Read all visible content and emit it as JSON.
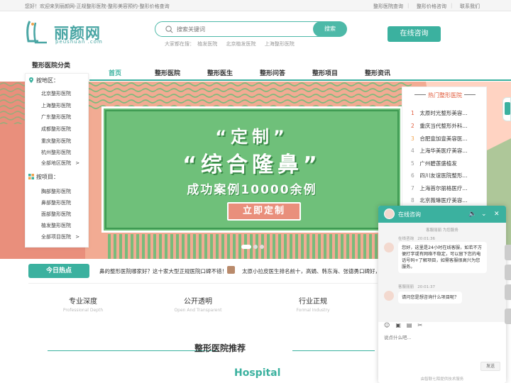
{
  "topbar": {
    "welcome": "您好！欢迎来到丽颜网-正规整形医院-整形美容预约-整形价格查询",
    "links": [
      "整形医院查询",
      "整形价格咨询",
      "联系我们"
    ],
    "sep": "|"
  },
  "logo": {
    "name": "丽颜网",
    "domain": "peushuan .com",
    "icon": "logo-mark"
  },
  "search": {
    "placeholder": "搜索关键词",
    "button": "搜索",
    "icon": "search-icon"
  },
  "hot": {
    "label": "大家都在搜：",
    "items": [
      "植发医院",
      "北京植发医院",
      "上海整形医院"
    ]
  },
  "consult_button": "在线咨询",
  "category_title": "整形医院分类",
  "nav": [
    "首页",
    "整形医院",
    "整形医生",
    "整形问答",
    "整形项目",
    "整形资讯"
  ],
  "left_menu": {
    "region": {
      "title": "按地区：",
      "icon": "location-pin-icon",
      "items": [
        "北京整形医院",
        "上海整形医院",
        "广东整形医院",
        "成都整形医院",
        "重庆整形医院",
        "杭州整形医院",
        "全部地区医院"
      ]
    },
    "project": {
      "title": "按项目：",
      "icon": "grid-icon",
      "items": [
        "胸部整形医院",
        "鼻部整形医院",
        "面部整形医院",
        "植发整形医院",
        "全部项目医院"
      ]
    },
    "more_arrow": ">"
  },
  "banner": {
    "line1": "“定制”",
    "line2": "“综合隆鼻”",
    "line3": "成功案例10000余例",
    "button": "立即定制",
    "colors": {
      "coral": "#e98f7c",
      "green": "#6bbd78",
      "teal": "#3bb19f"
    }
  },
  "rank": {
    "title": "热门整形医院",
    "items": [
      {
        "n": "1",
        "name": "太原时光整形美容..."
      },
      {
        "n": "2",
        "name": "重庆当代整形外科..."
      },
      {
        "n": "3",
        "name": "合肥壹加壹美容医..."
      },
      {
        "n": "4",
        "name": "上海华美医疗美容..."
      },
      {
        "n": "5",
        "name": "广州碧莲盛植发"
      },
      {
        "n": "6",
        "name": "四川友谊医院整形..."
      },
      {
        "n": "7",
        "name": "上海首尔丽格医疗..."
      },
      {
        "n": "8",
        "name": "北京薇琳医疗美容..."
      }
    ]
  },
  "today": {
    "label": "今日热点",
    "ticker1": "鼻的整形医院哪家好？这十家大型正规医院口碑不错！",
    "ticker2": "太原小拉皮医生排名前十，高娟、韩东海、张德勇口碑好，"
  },
  "features": [
    {
      "cn": "专业深度",
      "en": "Professional Depth"
    },
    {
      "cn": "公开透明",
      "en": "Open And Transparent"
    },
    {
      "cn": "行业正规",
      "en": "Formal Industry"
    }
  ],
  "recommend": {
    "title": "整形医院推荐",
    "subtitle": "Hospital"
  },
  "chat": {
    "title": "在线咨询",
    "service_note": "客服丽丽 为您服务",
    "agent_name": "在线咨询",
    "time1": "20:01:36",
    "msg1": "您好，这里是24小时在线客服，如若不方便打字或有网络不稳定，可以留下您的电话号码+了解项目，如需客服很高兴为您服务。",
    "agent2": "客服丽丽",
    "time2": "20:01:37",
    "msg2": "请问您是想咨询什么项目呢？",
    "input_placeholder": "说点什么吧...",
    "send": "发送",
    "footer": "由智联七陌提供技术服务",
    "header_icons": [
      "speaker-icon",
      "chevron-down-icon",
      "close-icon"
    ]
  }
}
